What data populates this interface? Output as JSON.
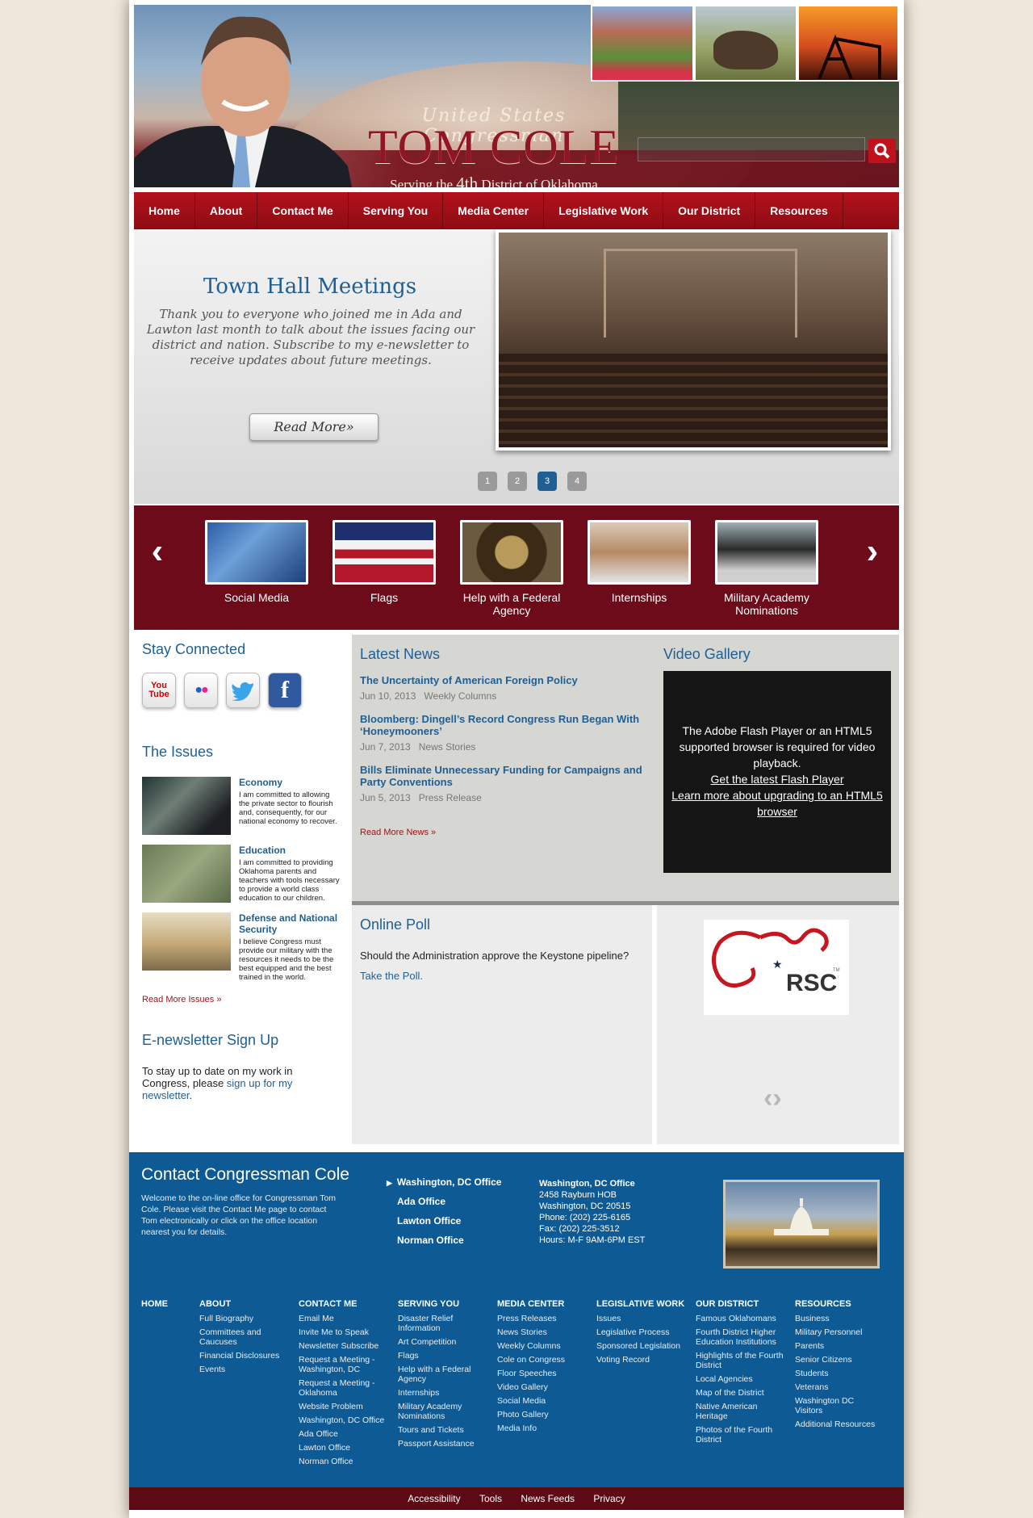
{
  "header": {
    "title_pre": "United States Congressman",
    "title_name": "TOM COLE",
    "subtitle_a": "Serving the",
    "subtitle_b": "4th",
    "subtitle_c": "District of Oklahoma"
  },
  "nav": [
    "Home",
    "About",
    "Contact Me",
    "Serving You",
    "Media Center",
    "Legislative Work",
    "Our District",
    "Resources"
  ],
  "slider": {
    "title": "Town Hall Meetings",
    "text": "Thank you to everyone who joined me in Ada and Lawton last month to talk about the issues facing our district and nation. Subscribe to my e-newsletter to receive updates about future meetings.",
    "button": "Read More»",
    "dots": [
      "1",
      "2",
      "3",
      "4"
    ],
    "active_dot": 3
  },
  "carousel": {
    "prev": "‹",
    "next": "›",
    "items": [
      "Social Media",
      "Flags",
      "Help with a Federal Agency",
      "Internships",
      "Military Academy Nominations"
    ]
  },
  "stay_connected": {
    "title": "Stay Connected",
    "icons": [
      "You Tube",
      "●●"
    ]
  },
  "issues": {
    "title": "The Issues",
    "items": [
      {
        "title": "Economy",
        "text": "I am committed to allowing the private sector to flourish and, consequently, for our national economy to recover."
      },
      {
        "title": "Education",
        "text": "I am committed to providing Oklahoma parents and teachers with tools necessary to provide a world class education to our children."
      },
      {
        "title": "Defense and National Security",
        "text": "I believe Congress must provide our military with the resources it needs to be the best equipped and the best trained in the world."
      }
    ],
    "more": "Read More Issues »"
  },
  "enewsletter": {
    "title": "E-newsletter Sign Up",
    "text_a": "To stay up to date on my work in Congress, please ",
    "link": "sign up for my newsletter",
    "text_b": "."
  },
  "news": {
    "title": "Latest News",
    "items": [
      {
        "title": "The Uncertainty of American Foreign Policy",
        "date": "Jun 10, 2013",
        "category": "Weekly Columns"
      },
      {
        "title": "Bloomberg: Dingell’s Record Congress Run Began With ‘Honeymooners’",
        "date": "Jun 7, 2013",
        "category": "News Stories"
      },
      {
        "title": "Bills Eliminate Unnecessary Funding for Campaigns and Party Conventions",
        "date": "Jun 5, 2013",
        "category": "Press Release"
      }
    ],
    "more": "Read More News »"
  },
  "video": {
    "title": "Video Gallery",
    "message": "The Adobe Flash Player or an HTML5 supported browser is required for video playback.",
    "link1": "Get the latest Flash Player",
    "link2": "Learn more about upgrading to an HTML5 browser"
  },
  "poll": {
    "title": "Online Poll",
    "question": "Should the Administration approve the Keystone pipeline?",
    "link": "Take the Poll."
  },
  "rsc": {
    "logo_text": "RSC",
    "tm": "TM",
    "prev": "‹",
    "next": "›"
  },
  "footer": {
    "title": "Contact Congressman Cole",
    "text": "Welcome to the on-line office for Congressman Tom Cole. Please visit the Contact Me page to contact Tom electronically or click on the office location nearest you for details.",
    "offices": [
      "Washington, DC Office",
      "Ada Office",
      "Lawton Office",
      "Norman Office"
    ],
    "address": {
      "name": "Washington, DC Office",
      "line1": "2458 Rayburn HOB",
      "line2": "Washington, DC 20515",
      "phone": "Phone: (202) 225-6165",
      "fax": "Fax: (202) 225-3512",
      "hours": "Hours: M-F 9AM-6PM EST"
    },
    "columns": [
      {
        "head": "HOME",
        "links": []
      },
      {
        "head": "ABOUT",
        "links": [
          "Full Biography",
          "Committees and Caucuses",
          "Financial Disclosures",
          "Events"
        ]
      },
      {
        "head": "CONTACT ME",
        "links": [
          "Email Me",
          "Invite Me to Speak",
          "Newsletter Subscribe",
          "Request a Meeting - Washington, DC",
          "Request a Meeting - Oklahoma",
          "Website Problem",
          "Washington, DC Office",
          "Ada Office",
          "Lawton Office",
          "Norman Office"
        ]
      },
      {
        "head": "SERVING YOU",
        "links": [
          "Disaster Relief Information",
          "Art Competition",
          "Flags",
          "Help with a Federal Agency",
          "Internships",
          "Military Academy Nominations",
          "Tours and Tickets",
          "Passport Assistance"
        ]
      },
      {
        "head": "MEDIA CENTER",
        "links": [
          "Press Releases",
          "News Stories",
          "Weekly Columns",
          "Cole on Congress",
          "Floor Speeches",
          "Video Gallery",
          "Social Media",
          "Photo Gallery",
          "Media Info"
        ]
      },
      {
        "head": "LEGISLATIVE WORK",
        "links": [
          "Issues",
          "Legislative Process",
          "Sponsored Legislation",
          "Voting Record"
        ]
      },
      {
        "head": "OUR DISTRICT",
        "links": [
          "Famous Oklahomans",
          "Fourth District Higher Education Institutions",
          "Highlights of the Fourth District",
          "Local Agencies",
          "Map of the District",
          "Native American Heritage",
          "Photos of the Fourth District"
        ]
      },
      {
        "head": "RESOURCES",
        "links": [
          "Business",
          "Military Personnel",
          "Parents",
          "Senior Citizens",
          "Students",
          "Veterans",
          "Washington DC Visitors",
          "Additional Resources"
        ]
      }
    ]
  },
  "bottom_links": [
    "Accessibility",
    "Tools",
    "News Feeds",
    "Privacy"
  ]
}
